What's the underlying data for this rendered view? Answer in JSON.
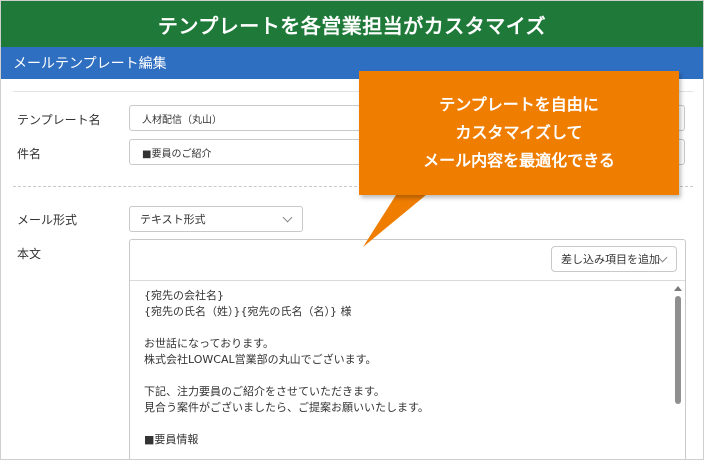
{
  "banner": {
    "title": "テンプレートを各営業担当がカスタマイズ"
  },
  "section": {
    "title": "メールテンプレート編集"
  },
  "form": {
    "template_name_label": "テンプレート名",
    "template_name_value": "人材配信（丸山）",
    "subject_label": "件名",
    "subject_value": "■要員のご紹介",
    "format_label": "メール形式",
    "format_value": "テキスト形式",
    "body_label": "本文",
    "insert_button_label": "差し込み項目を追加",
    "body_lines": [
      "{宛先の会社名}",
      "{宛先の氏名（姓）}{宛先の氏名（名）} 様",
      "",
      "お世話になっております。",
      "株式会社LOWCAL営業部の丸山でございます。",
      "",
      "下記、注力要員のご紹介をさせていただきます。",
      "見合う案件がございましたら、ご提案お願いいたします。",
      "",
      "■要員情報"
    ]
  },
  "callout": {
    "lines": [
      "テンプレートを自由に",
      "カスタマイズして",
      "メール内容を最適化できる"
    ]
  },
  "colors": {
    "banner_bg": "#1f7a3a",
    "section_bg": "#2f6fc1",
    "callout_bg": "#ef7d00"
  }
}
